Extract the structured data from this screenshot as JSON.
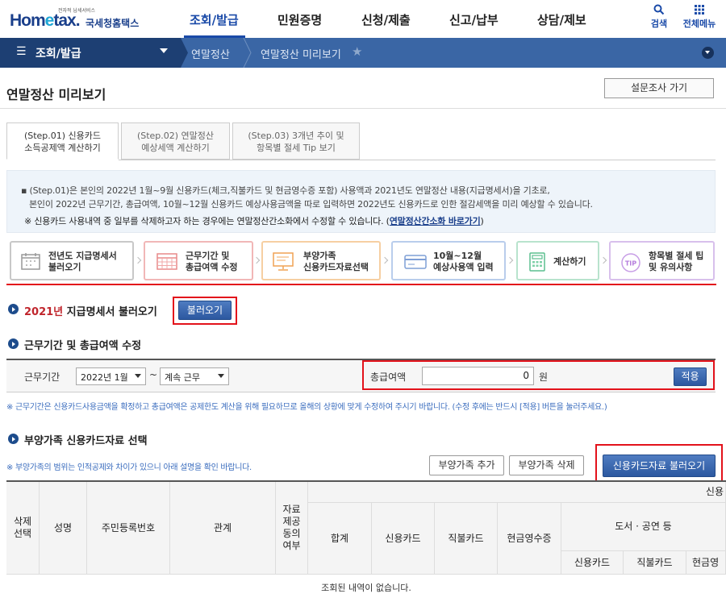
{
  "header": {
    "logo_small": "전자적 납세서비스",
    "logo_main_a": "Hom",
    "logo_main_e": "e",
    "logo_main_b": "tax.",
    "logo_kr": "국세청홈택스",
    "nav": [
      "조회/발급",
      "민원증명",
      "신청/제출",
      "신고/납부",
      "상담/제보"
    ],
    "search_label": "검색",
    "allmenu_label": "전체메뉴"
  },
  "bluebar": {
    "title": "조회/발급",
    "crumbs": [
      "연말정산",
      "연말정산 미리보기"
    ]
  },
  "page": {
    "title": "연말정산 미리보기",
    "survey_button": "설문조사 가기"
  },
  "step_tabs": [
    {
      "line1": "(Step.01) 신용카드",
      "line2": "소득공제액 계산하기"
    },
    {
      "line1": "(Step.02) 연말정산",
      "line2": "예상세액 계산하기"
    },
    {
      "line1": "(Step.03) 3개년 추이 및",
      "line2": "항목별 절세 Tip 보기"
    }
  ],
  "info": {
    "line1": "▪ (Step.01)은 본인의 2022년 1월~9월 신용카드(체크,직불카드 및 현금영수증 포함) 사용액과 2021년도 연말정산 내용(지급명세서)을 기초로,",
    "line2": "본인이 2022년 근무기간, 총급여액, 10월~12월 신용카드 예상사용금액을 따로 입력하면 2022년도 신용카드로 인한 절감세액을 미리 예상할 수 있습니다.",
    "line3": "※ 신용카드 사용내역 중 일부를 삭제하고자 하는 경우에는 연말정산간소화에서 수정할 수 있습니다. (",
    "link": "연말정산간소화 바로가기",
    "line3_end": ")"
  },
  "process": [
    {
      "line1": "전년도 지급명세서",
      "line2": "불러오기",
      "color": "#c8c8c8"
    },
    {
      "line1": "근무기간 및",
      "line2": "총급여액 수정",
      "color": "#f1b7b7"
    },
    {
      "line1": "부양가족",
      "line2": "신용카드자료선택",
      "color": "#f6cfa2"
    },
    {
      "line1": "10월~12월",
      "line2": "예상사용액 입력",
      "color": "#b9cdec"
    },
    {
      "line1": "계산하기",
      "line2": "",
      "color": "#b8e3cd"
    },
    {
      "line1": "항목별 절세 팁",
      "line2": "및 유의사항",
      "color": "#d8c0ec"
    }
  ],
  "section1": {
    "year": "2021년",
    "title": " 지급명세서 불러오기",
    "button": "불러오기"
  },
  "section2": {
    "title": "근무기간 및 총급여액 수정",
    "period_label": "근무기간",
    "start_value": "2022년 1월",
    "tilde": "~",
    "end_value": "계속 근무",
    "salary_label": "총급여액",
    "salary_value": "0",
    "unit": "원",
    "apply_button": "적용",
    "note": "※ 근무기간은 신용카드사용금액을 확정하고 총급여액은 공제한도 계산을 위해 필요하므로 올해의 상황에 맞게 수정하여 주시기 바랍니다. (수정 후에는 반드시 [적용] 버튼을 눌러주세요.)"
  },
  "section3": {
    "title": "부양가족 신용카드자료 선택",
    "note": "※ 부양가족의 범위는 인적공제와 차이가 있으니 아래 설명을 확인 바랍니다.",
    "add_button": "부양가족 추가",
    "delete_button": "부양가족 삭제",
    "load_button": "신용카드자료 불러오기"
  },
  "table": {
    "col_delete": "삭제\n선택",
    "col_name": "성명",
    "col_rrn": "주민등록번호",
    "col_relation": "관계",
    "col_consent": "자료\n제공\n동의\n여부",
    "group_header": "신용",
    "sub_total": "합계",
    "sub_credit": "신용카드",
    "sub_debit": "직불카드",
    "sub_cash": "현금영수증",
    "book_group": "도서 · 공연 등",
    "book_credit": "신용카드",
    "book_debit": "직불카드",
    "book_cash": "현금영",
    "empty": "조회된 내역이 없습니다."
  },
  "colors": {
    "brand_blue": "#1a3f8b",
    "bar_blue": "#3a66a5",
    "highlight_red": "#e3121b"
  }
}
